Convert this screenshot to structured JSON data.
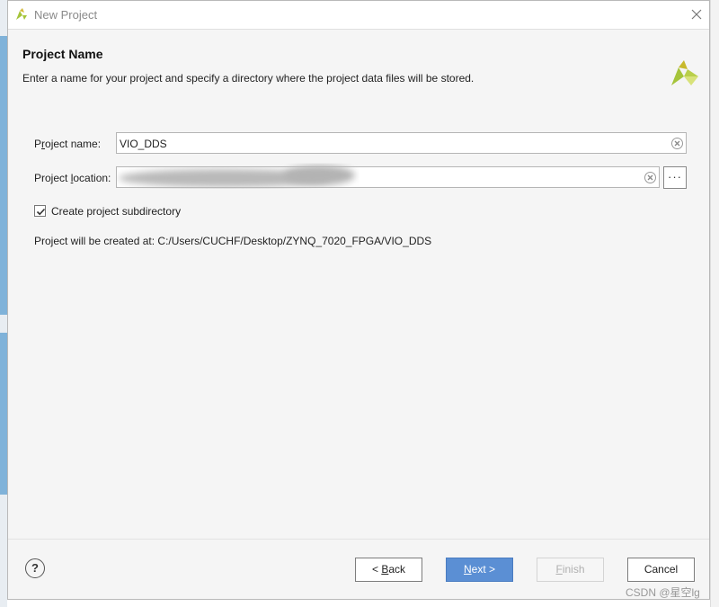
{
  "window": {
    "title": "New Project"
  },
  "header": {
    "title": "Project Name",
    "subtitle": "Enter a name for your project and specify a directory where the project data files will be stored."
  },
  "form": {
    "project_name_label_prefix": "P",
    "project_name_label_underlined": "r",
    "project_name_label_rest": "oject name:",
    "project_name_value": "VIO_DDS",
    "project_location_label_prefix": "Project ",
    "project_location_label_underlined": "l",
    "project_location_label_rest": "ocation:",
    "browse_label": "···",
    "subdirectory_label": "Create project subdirectory",
    "subdirectory_checked": true,
    "created_at_text": "Project will be created at: C:/Users/CUCHF/Desktop/ZYNQ_7020_FPGA/VIO_DDS"
  },
  "footer": {
    "help_label": "?",
    "back_prefix": "< ",
    "back_underlined": "B",
    "back_rest": "ack",
    "next_underlined": "N",
    "next_rest": "ext >",
    "finish_underlined": "F",
    "finish_rest": "inish",
    "cancel_label": "Cancel"
  },
  "watermark": "CSDN @星空lg",
  "colors": {
    "accent": "#5b8fd4",
    "logo": "#a5c43a"
  },
  "icons": [
    "vivado-logo-icon",
    "close-icon",
    "clear-icon",
    "check-icon",
    "help-icon"
  ]
}
